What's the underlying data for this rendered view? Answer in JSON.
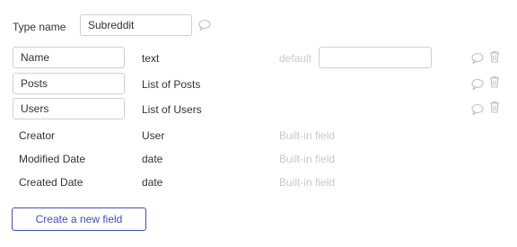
{
  "type_name": {
    "label": "Type name",
    "value": "Subreddit"
  },
  "fields": [
    {
      "name": "Name",
      "type": "text",
      "default_label": "default",
      "default_value": ""
    },
    {
      "name": "Posts",
      "type": "List of Posts"
    },
    {
      "name": "Users",
      "type": "List of Users"
    }
  ],
  "builtin_fields": [
    {
      "name": "Creator",
      "type": "User",
      "note": "Built-in field"
    },
    {
      "name": "Modified Date",
      "type": "date",
      "note": "Built-in field"
    },
    {
      "name": "Created Date",
      "type": "date",
      "note": "Built-in field"
    }
  ],
  "actions": {
    "create_field_label": "Create a new field"
  },
  "icons": {
    "comment": "comment-icon",
    "trash": "trash-icon"
  },
  "colors": {
    "accent": "#3f51b5",
    "muted_text": "#c9c9c9",
    "border": "#d0d0d0",
    "icon": "#c0c0c0"
  }
}
